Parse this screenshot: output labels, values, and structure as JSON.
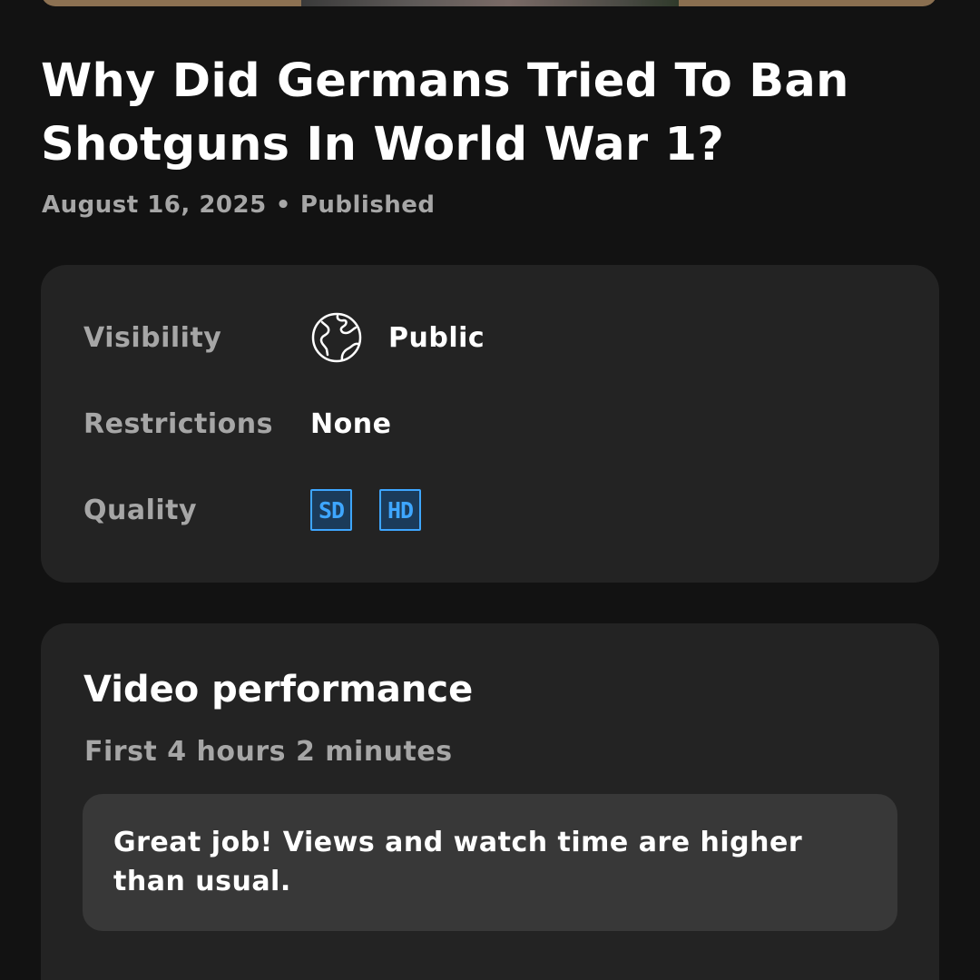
{
  "video": {
    "title": "Why Did Germans Tried To Ban Shotguns In World War 1?",
    "date": "August 16, 2025",
    "separator": "•",
    "status": "Published"
  },
  "details": {
    "visibility_label": "Visibility",
    "visibility_icon": "globe-icon",
    "visibility_value": "Public",
    "restrictions_label": "Restrictions",
    "restrictions_value": "None",
    "quality_label": "Quality",
    "quality_badges": [
      "SD",
      "HD"
    ]
  },
  "performance": {
    "title": "Video performance",
    "subtitle": "First 4 hours 2 minutes",
    "message": "Great job! Views and watch time are higher than usual."
  },
  "colors": {
    "background": "#121212",
    "card": "#232323",
    "message_box": "#383838",
    "muted_text": "#a6a6a6",
    "quality_accent": "#3ea6ff"
  }
}
